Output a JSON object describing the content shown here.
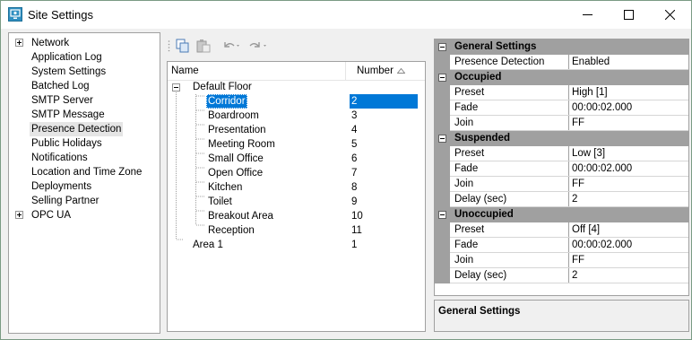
{
  "window": {
    "title": "Site Settings"
  },
  "nav": {
    "items": [
      {
        "label": "Network",
        "expandable": true
      },
      {
        "label": "Application Log"
      },
      {
        "label": "System Settings"
      },
      {
        "label": "Batched Log"
      },
      {
        "label": "SMTP Server"
      },
      {
        "label": "SMTP Message"
      },
      {
        "label": "Presence Detection",
        "selected": true
      },
      {
        "label": "Public Holidays"
      },
      {
        "label": "Notifications"
      },
      {
        "label": "Location and Time Zone"
      },
      {
        "label": "Deployments"
      },
      {
        "label": "Selling Partner"
      },
      {
        "label": "OPC UA",
        "expandable": true
      }
    ]
  },
  "toolbar": {
    "icons": [
      "copy-icon",
      "paste-icon",
      "undo-icon",
      "redo-icon"
    ]
  },
  "tree": {
    "columns": {
      "name": "Name",
      "number": "Number"
    },
    "root": {
      "name": "Default Floor"
    },
    "rooms": [
      {
        "name": "Corridor",
        "number": "2",
        "selected": true
      },
      {
        "name": "Boardroom",
        "number": "3"
      },
      {
        "name": "Presentation",
        "number": "4"
      },
      {
        "name": "Meeting Room",
        "number": "5"
      },
      {
        "name": "Small Office",
        "number": "6"
      },
      {
        "name": "Open Office",
        "number": "7"
      },
      {
        "name": "Kitchen",
        "number": "8"
      },
      {
        "name": "Toilet",
        "number": "9"
      },
      {
        "name": "Breakout Area",
        "number": "10"
      },
      {
        "name": "Reception",
        "number": "11"
      }
    ],
    "area": {
      "name": "Area 1",
      "number": "1"
    }
  },
  "properties": {
    "general": {
      "title": "General Settings",
      "presence_label": "Presence Detection",
      "presence_value": "Enabled"
    },
    "occupied": {
      "title": "Occupied",
      "rows": [
        {
          "k": "Preset",
          "v": "High [1]"
        },
        {
          "k": "Fade",
          "v": "00:00:02.000"
        },
        {
          "k": "Join",
          "v": "FF"
        }
      ]
    },
    "suspended": {
      "title": "Suspended",
      "rows": [
        {
          "k": "Preset",
          "v": "Low [3]"
        },
        {
          "k": "Fade",
          "v": "00:00:02.000"
        },
        {
          "k": "Join",
          "v": "FF"
        },
        {
          "k": "Delay (sec)",
          "v": "2"
        }
      ]
    },
    "unoccupied": {
      "title": "Unoccupied",
      "rows": [
        {
          "k": "Preset",
          "v": "Off [4]"
        },
        {
          "k": "Fade",
          "v": "00:00:02.000"
        },
        {
          "k": "Join",
          "v": "FF"
        },
        {
          "k": "Delay (sec)",
          "v": "2"
        }
      ]
    }
  },
  "description": {
    "title": "General Settings"
  },
  "colors": {
    "selection": "#0078d7",
    "category_bg": "#a0a0a0"
  }
}
